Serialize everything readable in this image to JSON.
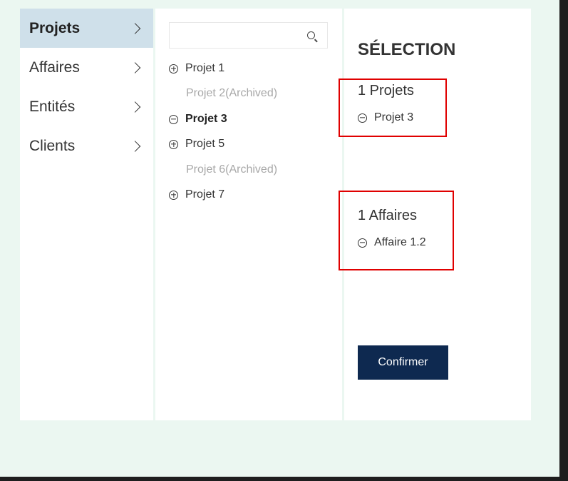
{
  "sidebar": {
    "items": [
      {
        "label": "Projets"
      },
      {
        "label": "Affaires"
      },
      {
        "label": "Entités"
      },
      {
        "label": "Clients"
      }
    ]
  },
  "list": {
    "search": {
      "value": "",
      "placeholder": ""
    },
    "items": [
      {
        "label": "Projet 1",
        "state": "collapsed",
        "icon": "plus-circle-icon"
      },
      {
        "label": "Projet 2(Archived)",
        "state": "archived"
      },
      {
        "label": "Projet 3",
        "state": "selected",
        "icon": "minus-circle-icon"
      },
      {
        "label": "Projet 5",
        "state": "collapsed",
        "icon": "plus-circle-icon"
      },
      {
        "label": "Projet 6(Archived)",
        "state": "archived"
      },
      {
        "label": "Projet 7",
        "state": "collapsed",
        "icon": "plus-circle-icon"
      }
    ]
  },
  "selection": {
    "title": "SÉLECTION",
    "groups": [
      {
        "heading": "1 Projets",
        "items": [
          {
            "label": "Projet 3"
          }
        ]
      },
      {
        "heading": "1 Affaires",
        "items": [
          {
            "label": "Affaire 1.2"
          }
        ]
      }
    ],
    "confirm_label": "Confirmer"
  },
  "colors": {
    "background": "#ebf7f1",
    "active_nav": "#cfe0ea",
    "confirm_button": "#0e2950",
    "highlight_border": "#e00000",
    "archived_text": "#a8a8a8"
  }
}
